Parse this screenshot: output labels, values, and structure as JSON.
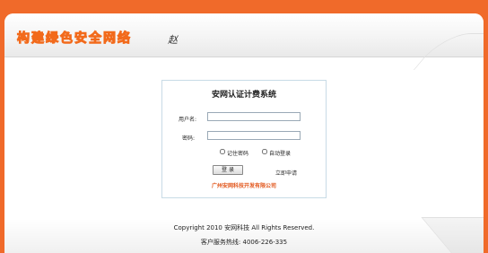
{
  "header": {
    "slogan": "构建绿色安全网络",
    "signature": "赵"
  },
  "login": {
    "title": "安网认证计费系统",
    "username_label": "用户名:",
    "username_value": "",
    "password_label": "密码:",
    "password_value": "",
    "remember_label": "记住密码",
    "remember_checked": false,
    "auto_login_label": "自动登录",
    "auto_login_checked": false,
    "login_button": "登 录",
    "apply_link": "立即申请",
    "company": "广州安网科技开发有限公司"
  },
  "footer": {
    "copyright": "Copyright 2010 安网科技  All Rights Reserved.",
    "hotline": "客户服务热线: 4006-226-335"
  },
  "colors": {
    "frame": "#f06a2a",
    "accent": "#e2571c",
    "box_border": "#c8dbe6"
  }
}
